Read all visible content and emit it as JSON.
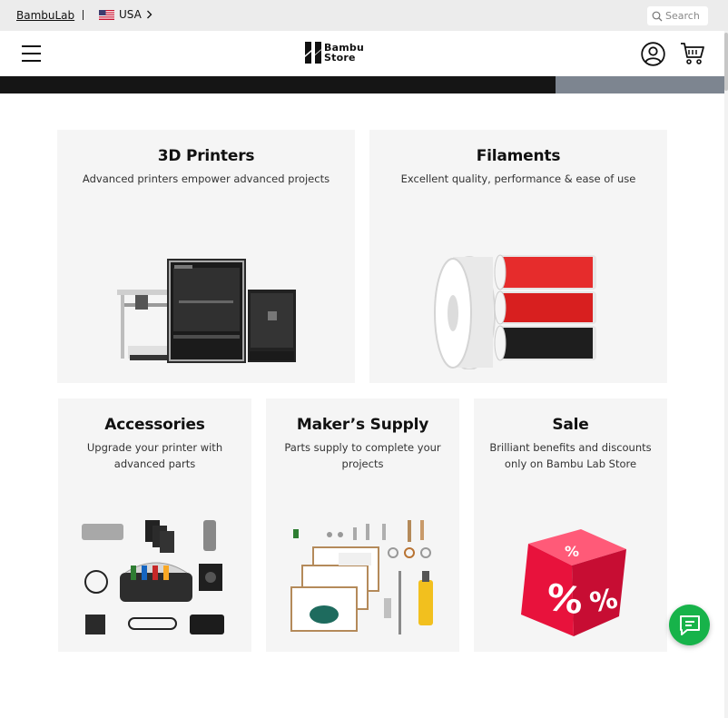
{
  "topbar": {
    "brand_link": "BambuLab",
    "region": "USA",
    "search_placeholder": "Search"
  },
  "header": {
    "logo_line1": "Bambu",
    "logo_line2": "Store"
  },
  "categories": [
    {
      "title": "3D Printers",
      "subtitle": "Advanced printers empower advanced projects",
      "image_icon": "3d-printers-image"
    },
    {
      "title": "Filaments",
      "subtitle": "Excellent quality, performance & ease of use",
      "image_icon": "filament-spools-image"
    },
    {
      "title": "Accessories",
      "subtitle": "Upgrade your printer with advanced parts",
      "image_icon": "accessories-image"
    },
    {
      "title": "Maker’s Supply",
      "subtitle": "Parts supply to complete your projects",
      "image_icon": "makers-supply-image"
    },
    {
      "title": "Sale",
      "subtitle": "Brilliant benefits and discounts only on Bambu Lab Store",
      "image_icon": "sale-dice-image"
    }
  ],
  "colors": {
    "topbar_bg": "#ececec",
    "card_bg": "#f5f5f5",
    "chat_green": "#17b34a",
    "sale_red": "#e8123c"
  }
}
